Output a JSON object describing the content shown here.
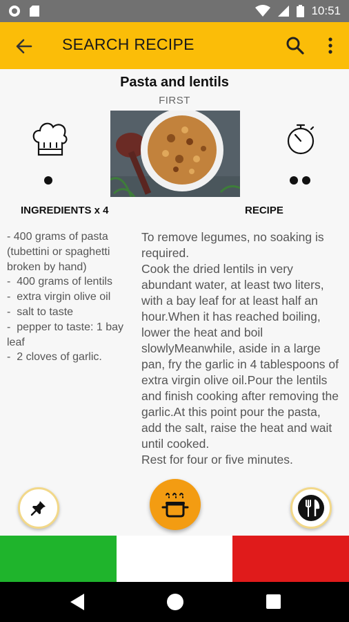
{
  "status_bar": {
    "time": "10:51",
    "icons": [
      "record-icon",
      "sd-card-icon",
      "wifi-icon",
      "signal-icon",
      "battery-icon"
    ]
  },
  "app_bar": {
    "title": "SEARCH RECIPE",
    "color": "#fbbd08",
    "icons": [
      "back-arrow-icon",
      "search-icon",
      "more-vert-icon"
    ]
  },
  "recipe": {
    "title": "Pasta and lentils",
    "category": "FIRST",
    "difficulty_level": 1,
    "time_level": 2,
    "ingredients_header": "INGREDIENTS x 4",
    "recipe_header": "RECIPE",
    "ingredients": [
      "- 400 grams of pasta (tubettini or spaghetti broken by hand)",
      "-  400 grams of lentils",
      "-  extra virgin olive oil",
      "-  salt to taste",
      "-  pepper to taste: 1 bay leaf",
      "-  2 cloves of garlic."
    ],
    "instructions": "To remove legumes, no soaking is required.\nCook the dried lentils in very abundant water, at least two liters, with a bay leaf for at least half an hour.When it has reached boiling, lower the heat and boil slowlyMeanwhile, aside in a large pan, fry the garlic in 4 tablespoons of extra virgin olive oil.Pour the lentils and finish cooking after removing the garlic.At this point pour the pasta, add the salt, raise the heat and wait until cooked.\nRest for four or five minutes."
  },
  "fabs": [
    {
      "name": "pin",
      "icon": "pin-icon"
    },
    {
      "name": "cook",
      "icon": "cooking-pot-icon",
      "color": "#f39c12"
    },
    {
      "name": "menu",
      "icon": "fork-knife-icon"
    }
  ],
  "flag_colors": [
    "#1fb42c",
    "#ffffff",
    "#e01b1b"
  ]
}
